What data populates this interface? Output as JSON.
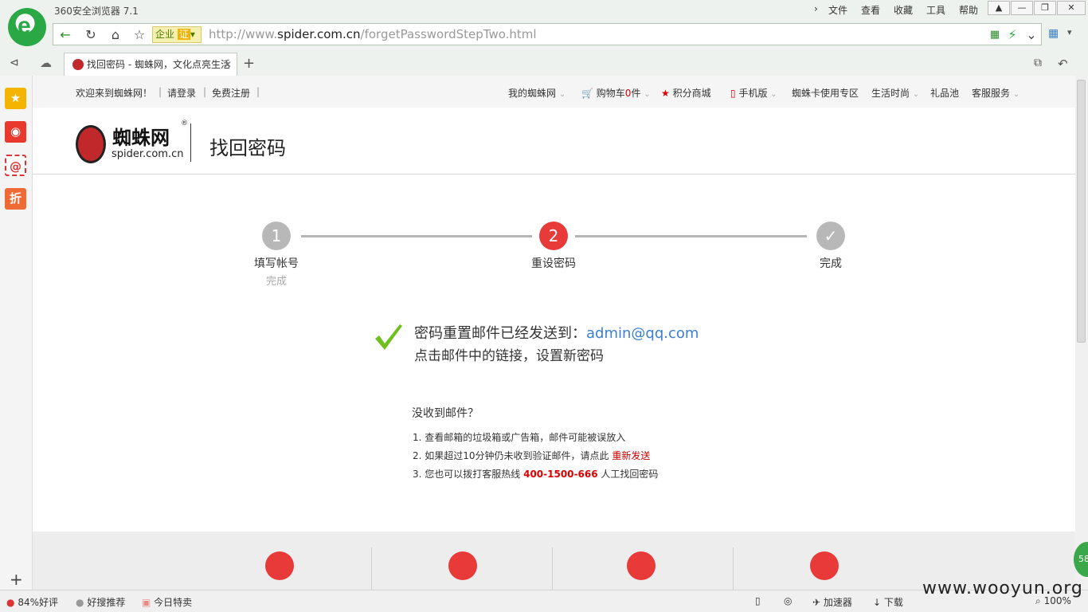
{
  "browser": {
    "title": "360安全浏览器 7.1",
    "menus": [
      "文件",
      "查看",
      "收藏",
      "工具",
      "帮助"
    ],
    "enterprise_label": "企业",
    "cert_label": "证",
    "url_prefix": "http://www.",
    "url_domain": "spider.com.cn",
    "url_path": "/forgetPasswordStepTwo.html",
    "tab_title": "找回密码 - 蜘蛛网，文化点亮生活"
  },
  "statusbar": {
    "rating": "84%好评",
    "recommend": "好搜推荐",
    "deals": "今日特卖",
    "accelerator": "加速器",
    "download": "下载",
    "zoom": "100%"
  },
  "topnav": {
    "welcome": "欢迎来到蜘蛛网！",
    "login": "请登录",
    "register": "免费注册",
    "my_spider": "我的蜘蛛网",
    "cart_prefix": "购物车",
    "cart_count": "0",
    "cart_suffix": "件",
    "points": "积分商城",
    "mobile": "手机版",
    "card_zone": "蜘蛛卡使用专区",
    "life": "生活时尚",
    "gift": "礼品池",
    "service": "客服服务"
  },
  "header": {
    "brand": "蜘蛛网",
    "brand_sub": "spider.com.cn",
    "page_title": "找回密码"
  },
  "steps": [
    {
      "num": "1",
      "label": "填写帐号",
      "sub": "完成",
      "color": "#b8b8b8"
    },
    {
      "num": "2",
      "label": "重设密码",
      "sub": "",
      "color": "#e93a3a"
    },
    {
      "num": "✓",
      "label": "完成",
      "sub": "",
      "color": "#b8b8b8"
    }
  ],
  "message": {
    "line1": "密码重置邮件已经发送到：",
    "email": "admin@qq.com",
    "line2": "点击邮件中的链接，设置新密码"
  },
  "help": {
    "question": "没收到邮件？",
    "tip1": "1. 查看邮箱的垃圾箱或广告箱，邮件可能被误放入",
    "tip2_prefix": "2. 如果超过10分钟仍未收到验证邮件，请点此",
    "tip2_link": "重新发送",
    "tip3_prefix": "3. 您也可以拨打客服热线",
    "tip3_phone": "400-1500-666",
    "tip3_suffix": "人工找回密码"
  },
  "watermark": "www.wooyun.org",
  "float_badge": "58"
}
